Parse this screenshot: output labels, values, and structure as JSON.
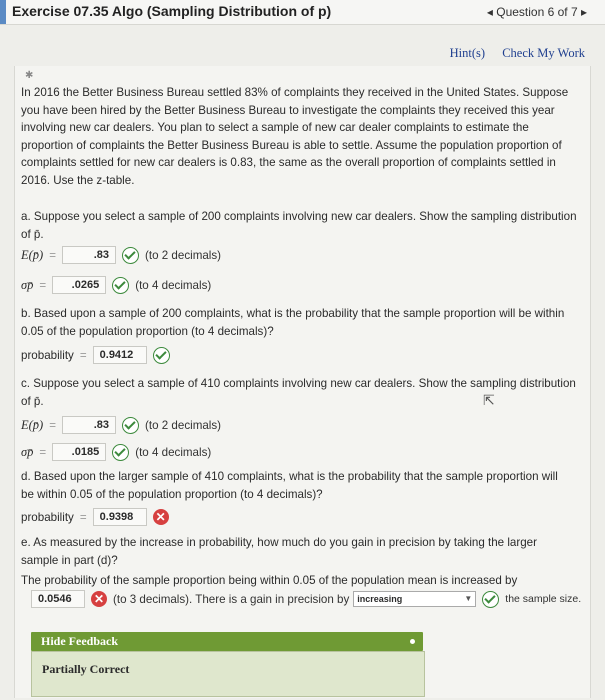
{
  "header": {
    "title": "Exercise 07.35 Algo (Sampling Distribution of p)",
    "question_nav": "◂ Question 6 of 7 ▸"
  },
  "links": {
    "hints": "Hint(s)",
    "check_my_work": "Check My Work"
  },
  "intro": {
    "p1": "In 2016 the Better Business Bureau settled 83% of complaints they received in the United States. Suppose",
    "p2": "you have been hired by the Better Business Bureau to investigate the complaints they received this year",
    "p3": "involving new car dealers. You plan to select a sample of new car dealer complaints to estimate the",
    "p4": "proportion of complaints the Better Business Bureau is able to settle. Assume the population proportion of",
    "p5": "complaints settled for new car dealers is 0.83, the same as the overall proportion of complaints settled in",
    "p6": "2016. Use the z-table."
  },
  "part_a": {
    "q1": "a. Suppose you select a sample of 200 complaints involving new car dealers. Show the sampling distribution",
    "q2": "of p̄.",
    "e_label": "E(p̄)",
    "e_value": ".83",
    "e_hint": "(to 2 decimals)",
    "sd_label": "σp̄",
    "sd_value": ".0265",
    "sd_hint": "(to 4 decimals)"
  },
  "part_b": {
    "q1": "b. Based upon a sample of 200 complaints, what is the probability that the sample proportion will be within",
    "q2": "0.05 of the population proportion (to 4 decimals)?",
    "label": "probability",
    "value": "0.9412"
  },
  "part_c": {
    "q1": "c. Suppose you select a sample of 410 complaints involving new car dealers. Show the sampling distribution",
    "q2": "of p̄.",
    "e_label": "E(p̄)",
    "e_value": ".83",
    "e_hint": "(to 2 decimals)",
    "sd_label": "σp̄",
    "sd_value": ".0185",
    "sd_hint": "(to 4 decimals)"
  },
  "part_d": {
    "q1": "d. Based upon the larger sample of 410 complaints, what is the probability that the sample proportion will",
    "q2": "be within 0.05 of the population proportion (to 4 decimals)?",
    "label": "probability",
    "value": "0.9398"
  },
  "part_e": {
    "q1": "e. As measured by the increase in probability, how much do you gain in precision by taking the larger",
    "q2": "sample in part (d)?",
    "q3": "The probability of the sample proportion being within 0.05 of the population mean is increased by",
    "value": "0.0546",
    "hint": "(to 3 decimals). There is a gain in precision by",
    "select_value": "increasing",
    "tail": "the sample size."
  },
  "feedback": {
    "toggle": "Hide Feedback",
    "status": "Partially Correct"
  },
  "colors": {
    "correct": "#3d8a3d",
    "incorrect": "#d64040",
    "feedback_bar": "#6f9a34"
  }
}
